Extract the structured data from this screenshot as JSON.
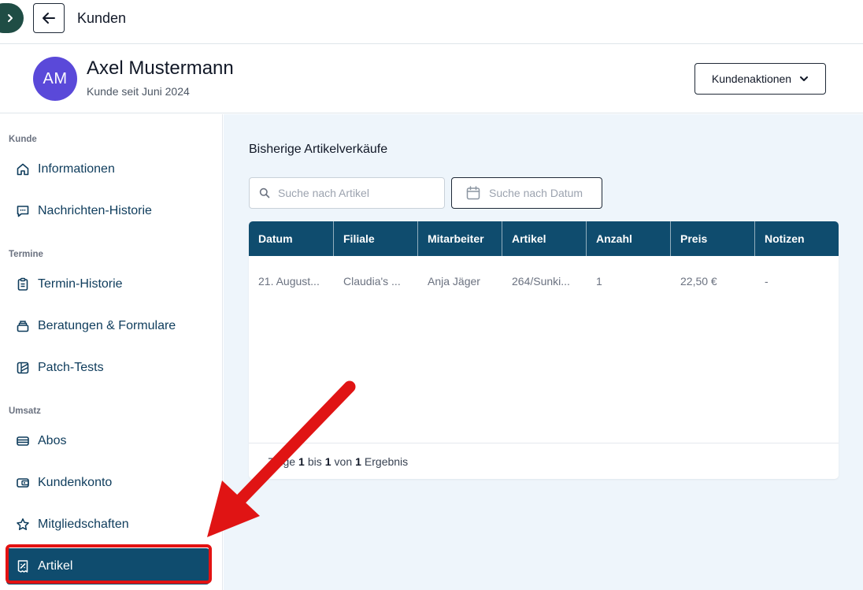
{
  "topbar": {
    "title": "Kunden"
  },
  "customer": {
    "initials": "AM",
    "name": "Axel Mustermann",
    "since": "Kunde seit Juni 2024",
    "actions_label": "Kundenaktionen"
  },
  "sidebar": {
    "groups": [
      {
        "label": "Kunde",
        "items": [
          {
            "label": "Informationen",
            "icon": "home-icon"
          },
          {
            "label": "Nachrichten-Historie",
            "icon": "message-icon"
          }
        ]
      },
      {
        "label": "Termine",
        "items": [
          {
            "label": "Termin-Historie",
            "icon": "clipboard-icon"
          },
          {
            "label": "Beratungen & Formulare",
            "icon": "forms-icon"
          },
          {
            "label": "Patch-Tests",
            "icon": "patch-icon"
          }
        ]
      },
      {
        "label": "Umsatz",
        "items": [
          {
            "label": "Abos",
            "icon": "subscription-icon"
          },
          {
            "label": "Kundenkonto",
            "icon": "wallet-icon"
          },
          {
            "label": "Mitgliedschaften",
            "icon": "star-icon"
          },
          {
            "label": "Artikel",
            "icon": "receipt-icon",
            "active": true
          }
        ]
      }
    ]
  },
  "main": {
    "section_title": "Bisherige Artikelverkäufe",
    "search_placeholder": "Suche nach Artikel",
    "date_placeholder": "Suche nach Datum",
    "table": {
      "columns": [
        "Datum",
        "Filiale",
        "Mitarbeiter",
        "Artikel",
        "Anzahl",
        "Preis",
        "Notizen"
      ],
      "rows": [
        [
          "21. August...",
          "Claudia's ...",
          "Anja Jäger",
          "264/Sunki...",
          "1",
          "22,50 €",
          "-"
        ]
      ]
    },
    "pagination": {
      "prefix": "Zeige",
      "from": "1",
      "to_word": "bis",
      "to": "1",
      "of_word": "von",
      "total": "1",
      "suffix": "Ergebnis"
    }
  },
  "colors": {
    "primary": "#0f4c6e",
    "avatar": "#5a49d9",
    "highlight": "#e31212",
    "background": "#eef5fb"
  }
}
